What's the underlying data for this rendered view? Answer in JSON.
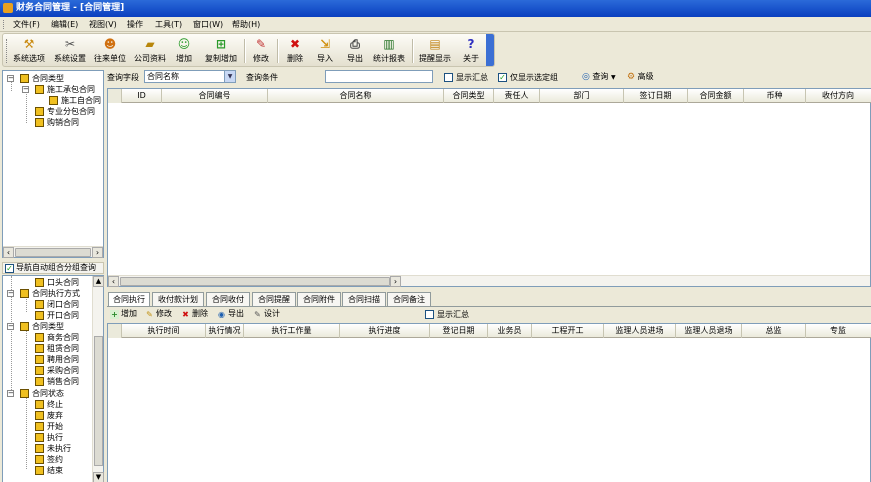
{
  "title": "财务合同管理 - [合同管理]",
  "menu": [
    "文件(F)",
    "编辑(E)",
    "视图(V)",
    "操作",
    "工具(T)",
    "窗口(W)",
    "帮助(H)"
  ],
  "toolbar": {
    "sys_options": "系统选项",
    "sys_settings": "系统设置",
    "partners": "往来单位",
    "company_info": "公司资料",
    "add": "增加",
    "copy_add": "复制增加",
    "edit": "修改",
    "delete": "删除",
    "import": "导入",
    "export": "导出",
    "report": "统计报表",
    "reminder": "提醒显示",
    "about": "关于"
  },
  "tree_top": {
    "root": "合同类型",
    "child1": "施工承包合同",
    "child1a": "施工自合同",
    "child2": "专业分包合同",
    "child3": "购销合同"
  },
  "nav_combo_label": "导航自动组合分组查询",
  "tree_bottom": {
    "item0": "口头合同",
    "group1": "合同执行方式",
    "g1a": "闭口合同",
    "g1b": "开口合同",
    "group2": "合同类型",
    "g2a": "商务合同",
    "g2b": "租赁合同",
    "g2c": "聘用合同",
    "g2d": "采购合同",
    "g2e": "销售合同",
    "group3": "合同状态",
    "g3a": "终止",
    "g3b": "废弃",
    "g3c": "开始",
    "g3d": "执行",
    "g3e": "未执行",
    "g3f": "签约",
    "g3g": "结束"
  },
  "query": {
    "field_label": "查询字段",
    "field_value": "合同名称",
    "cond_label": "查询条件",
    "cond_value": "",
    "show_summary": "显示汇总",
    "only_selected": "仅显示选定组",
    "search": "查询",
    "advanced": "高级"
  },
  "main_grid": {
    "columns": [
      "ID",
      "合同编号",
      "合同名称",
      "合同类型",
      "责任人",
      "部门",
      "签订日期",
      "合同金额",
      "币种",
      "收付方向"
    ]
  },
  "tabs": [
    "合同执行",
    "收付款计划",
    "合同收付",
    "合同提醒",
    "合同附件",
    "合同扫描",
    "合同备注"
  ],
  "sub_toolbar": {
    "add": "增加",
    "edit": "修改",
    "delete": "删除",
    "export": "导出",
    "design": "设计",
    "show_summary": "显示汇总"
  },
  "sub_grid": {
    "columns": [
      "执行时间",
      "执行情况",
      "执行工作量",
      "执行进度",
      "登记日期",
      "业务员",
      "工程开工",
      "监理人员进场",
      "监理人员退场",
      "总监",
      "专监"
    ]
  },
  "colors": {
    "titlebar": "#0a3fbf",
    "node": "#f0c020",
    "toolbar_end": "#3b6fd4"
  }
}
